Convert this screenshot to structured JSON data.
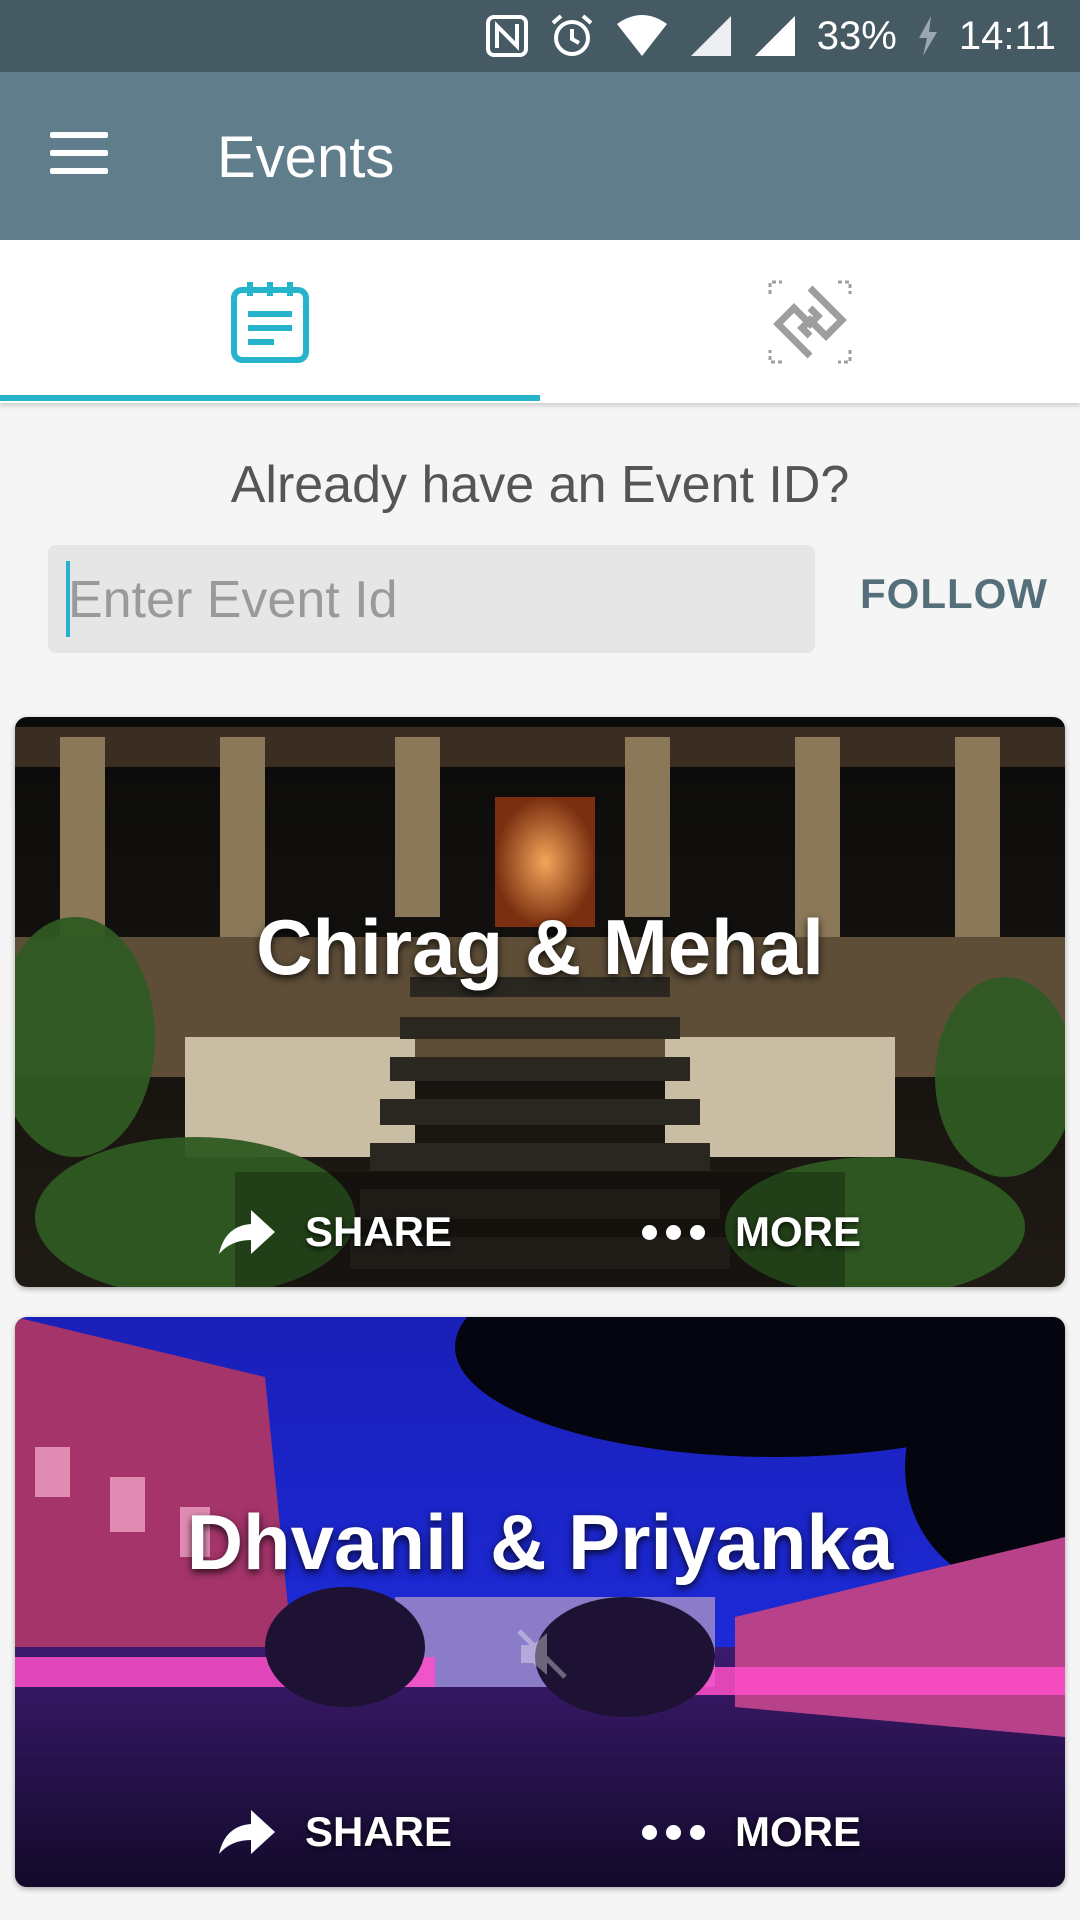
{
  "status_bar": {
    "battery": "33%",
    "time": "14:11",
    "icons": [
      "nfc-icon",
      "alarm-icon",
      "wifi-icon",
      "signal-icon",
      "signal-icon",
      "charging-icon"
    ]
  },
  "app_bar": {
    "title": "Events",
    "menu_icon": "hamburger-menu-icon"
  },
  "tabs": [
    {
      "icon": "event-calendar-icon",
      "active": true
    },
    {
      "icon": "qr-scan-icon",
      "active": false
    }
  ],
  "join": {
    "heading": "Already have an Event ID?",
    "placeholder": "Enter Event Id",
    "value": "",
    "follow_label": "FOLLOW"
  },
  "events": [
    {
      "name": "Chirag & Mehal",
      "share_label": "SHARE",
      "more_label": "MORE"
    },
    {
      "name": "Dhvanil & Priyanka",
      "share_label": "SHARE",
      "more_label": "MORE"
    }
  ],
  "colors": {
    "status_bar": "#465a64",
    "app_bar": "#607d8b",
    "accent": "#26b3cc",
    "follow": "#546e7a"
  }
}
